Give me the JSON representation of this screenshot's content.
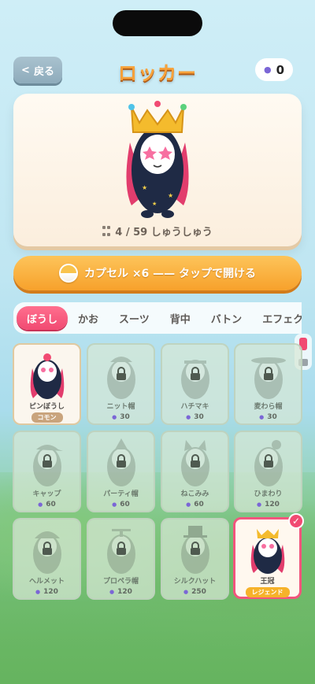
{
  "header": {
    "back_label": "戻る",
    "title": "ロッカー",
    "coins": "0"
  },
  "preview": {
    "count": "4 / 59 しゅうしゅう"
  },
  "capsule_button": {
    "label": "カプセル ×6 —— タップで開ける"
  },
  "tabs": [
    {
      "label": "ぼうし"
    },
    {
      "label": "かお"
    },
    {
      "label": "スーツ"
    },
    {
      "label": "背中"
    },
    {
      "label": "バトン"
    },
    {
      "label": "エフェク"
    }
  ],
  "items": [
    {
      "name": "ピンぼうし",
      "badge": "コモン",
      "state": "unlocked"
    },
    {
      "name": "ニット帽",
      "price": "30",
      "state": "locked"
    },
    {
      "name": "ハチマキ",
      "price": "30",
      "state": "locked"
    },
    {
      "name": "麦わら帽",
      "price": "30",
      "state": "locked"
    },
    {
      "name": "キャップ",
      "price": "60",
      "state": "locked"
    },
    {
      "name": "パーティ帽",
      "price": "60",
      "state": "locked"
    },
    {
      "name": "ねこみみ",
      "price": "60",
      "state": "locked"
    },
    {
      "name": "ひまわり",
      "price": "120",
      "state": "locked"
    },
    {
      "name": "ヘルメット",
      "price": "120",
      "state": "locked"
    },
    {
      "name": "プロペラ帽",
      "price": "120",
      "state": "locked"
    },
    {
      "name": "シルクハット",
      "price": "250",
      "state": "locked"
    },
    {
      "name": "王冠",
      "badge": "レジェンド",
      "state": "selected"
    }
  ],
  "colors": {
    "accent_pink": "#f14a72",
    "accent_orange": "#f7a12b",
    "title_orange": "#f7a23a"
  }
}
